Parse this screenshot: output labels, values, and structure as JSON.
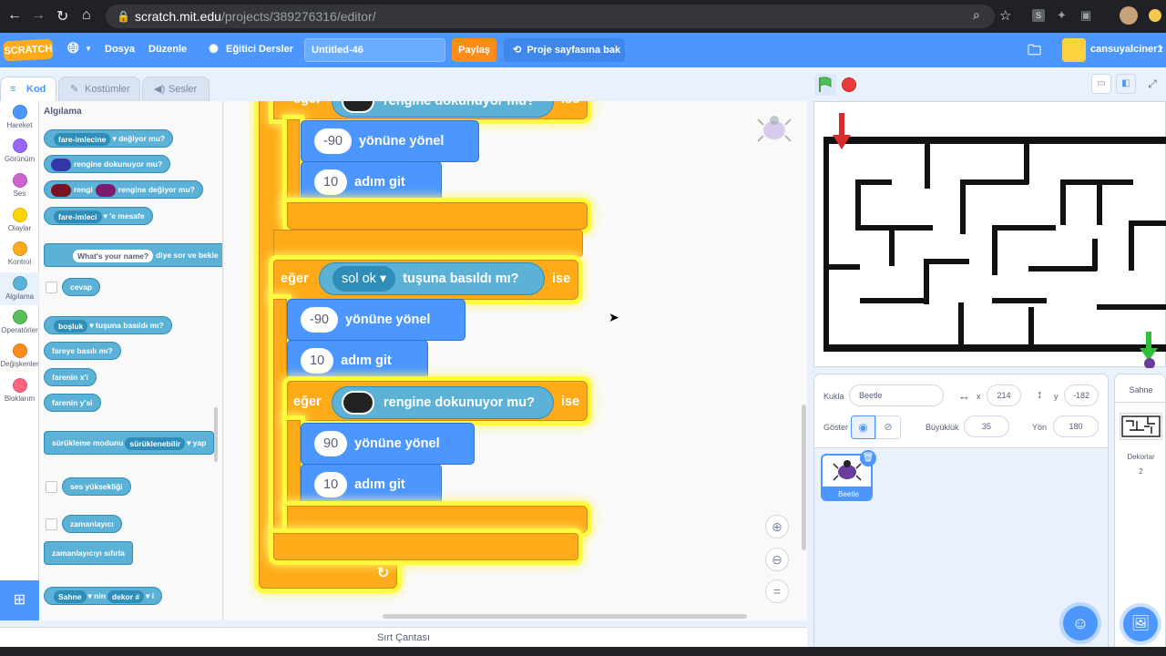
{
  "browser": {
    "url_host": "scratch.mit.edu",
    "url_path": "/projects/389276316/editor/"
  },
  "menu": {
    "logo": "SCRATCH",
    "file": "Dosya",
    "edit": "Düzenle",
    "tutorials": "Eğitici Dersler",
    "project_title": "Untitled-46",
    "share": "Paylaş",
    "project_page": "Proje sayfasına bak",
    "username": "cansuyalciner1"
  },
  "tabs": {
    "code": "Kod",
    "costumes": "Kostümler",
    "sounds": "Sesler"
  },
  "categories": [
    {
      "label": "Hareket",
      "color": "#4c97ff"
    },
    {
      "label": "Görünüm",
      "color": "#9966ff"
    },
    {
      "label": "Ses",
      "color": "#cf63cf"
    },
    {
      "label": "Olaylar",
      "color": "#ffd500"
    },
    {
      "label": "Kontrol",
      "color": "#ffab19"
    },
    {
      "label": "Algılama",
      "color": "#5cb1d6"
    },
    {
      "label": "Operatörler",
      "color": "#59c059"
    },
    {
      "label": "Değişkenler",
      "color": "#ff8c1a"
    },
    {
      "label": "Bloklarım",
      "color": "#ff6680"
    }
  ],
  "palette": {
    "heading": "Algılama",
    "b1_dd": "fare-imlecine",
    "b1_t": "değiyor mu?",
    "b2_t": "rengine dokunuyor mu?",
    "b3_a": "rengi",
    "b3_b": "rengine değiyor mu?",
    "b4_dd": "fare-imleci",
    "b4_t": "'e mesafe",
    "b5_in": "What's your name?",
    "b5_t": "diye sor ve bekle",
    "b6": "cevap",
    "b7_dd": "boşluk",
    "b7_t": "tuşuna basıldı mı?",
    "b8": "fareye basılı mı?",
    "b9": "farenin x'i",
    "b10": "farenin y'si",
    "b11_a": "sürükleme modunu",
    "b11_dd": "sürüklenebilir",
    "b11_b": "yap",
    "b12": "ses yüksekliği",
    "b13": "zamanlayıcı",
    "b14": "zamanlayıcıyı sıfırla",
    "b15_dd1": "Sahne",
    "b15_t": "nin",
    "b15_dd2": "dekor #",
    "b15_end": "i"
  },
  "script": {
    "if_kw": "eğer",
    "then_kw": "ise",
    "touch_color": "rengine dokunuyor mu?",
    "point_dir": "yönüne yönel",
    "move": "adım git",
    "key_pressed": "tuşuna basıldı mı?",
    "key_left": "sol ok",
    "v_top_dir": "-90",
    "v_top_steps": "10",
    "v_mid_dir": "-90",
    "v_mid_steps": "10",
    "v_bot_dir": "90",
    "v_bot_steps": "10",
    "loop_arrow": "↻"
  },
  "sprite_info": {
    "sprite_label": "Kukla",
    "sprite_name": "Beetle",
    "x_label": "x",
    "x_value": "214",
    "y_label": "y",
    "y_value": "-182",
    "show_label": "Göster",
    "size_label": "Büyüklük",
    "size_value": "35",
    "direction_label": "Yön",
    "direction_value": "180"
  },
  "sprite_list": [
    {
      "name": "Beetle"
    }
  ],
  "stage_panel": {
    "title": "Sahne",
    "backdrops_label": "Dekorlar",
    "backdrops_count": "2"
  },
  "backpack": "Sırt Çantası"
}
